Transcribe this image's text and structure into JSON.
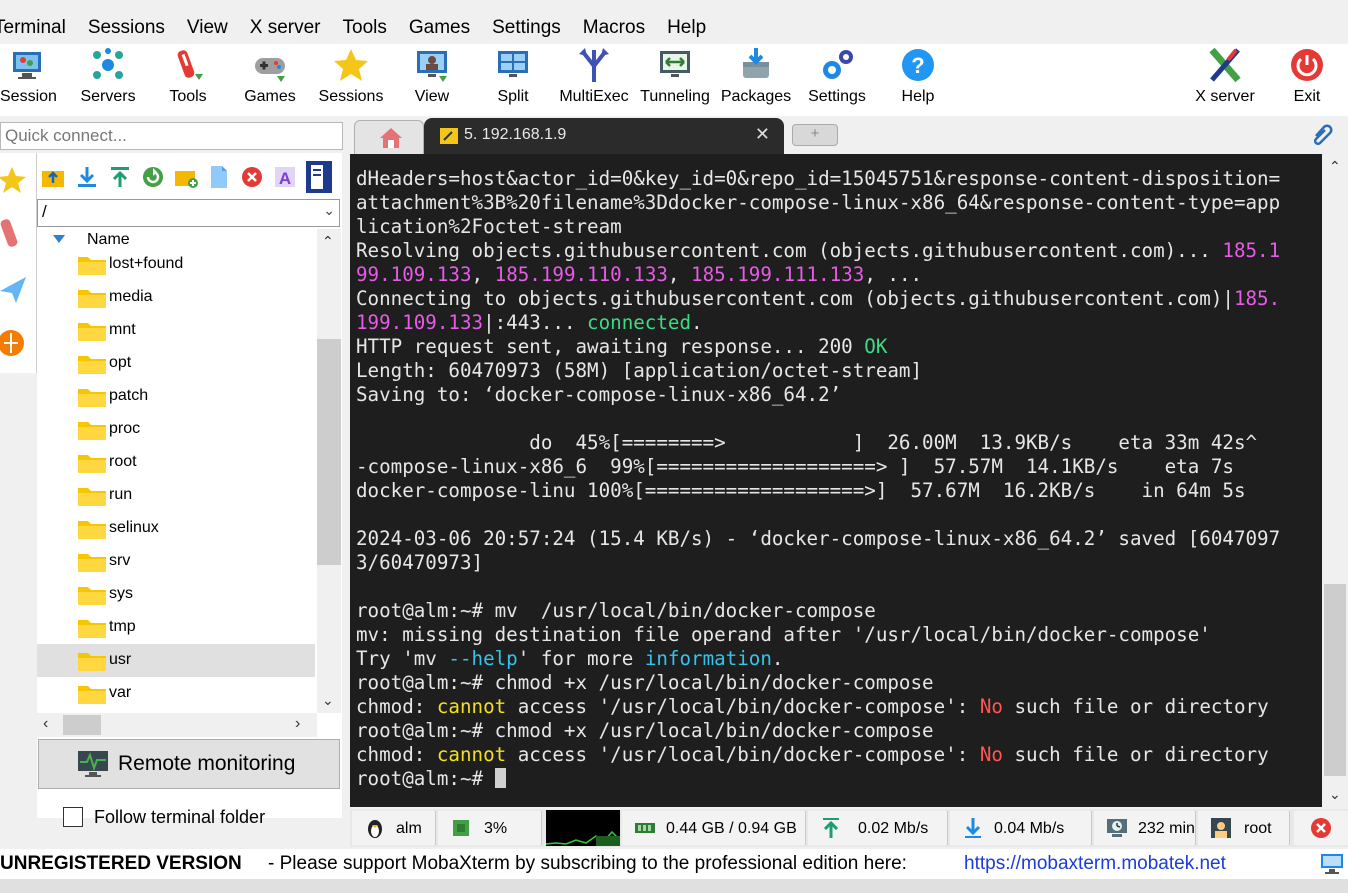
{
  "menu": [
    "Terminal",
    "Sessions",
    "View",
    "X server",
    "Tools",
    "Games",
    "Settings",
    "Macros",
    "Help"
  ],
  "toolbar": {
    "session": "Session",
    "servers": "Servers",
    "tools": "Tools",
    "games": "Games",
    "sessions": "Sessions",
    "view": "View",
    "split": "Split",
    "multiexec": "MultiExec",
    "tunneling": "Tunneling",
    "packages": "Packages",
    "settings": "Settings",
    "help": "Help",
    "xserver": "X server",
    "exit": "Exit"
  },
  "quick_connect": {
    "placeholder": "Quick connect..."
  },
  "tabs": {
    "active_label": "5. 192.168.1.9",
    "close": "✕",
    "add": "+"
  },
  "sftp": {
    "path": "/",
    "column_name": "Name",
    "items": [
      "lost+found",
      "media",
      "mnt",
      "opt",
      "patch",
      "proc",
      "root",
      "run",
      "selinux",
      "srv",
      "sys",
      "tmp",
      "usr",
      "var"
    ],
    "selected": "usr",
    "remote_monitoring": "Remote monitoring",
    "follow_terminal": "Follow terminal folder"
  },
  "terminal": {
    "lines": [
      [
        {
          "t": "dHeaders=host&actor_id=0&key_id=0&repo_id=15045751&response-content-disposition="
        }
      ],
      [
        {
          "t": "attachment%3B%20filename%3Ddocker-compose-linux-x86_64&response-content-type=app"
        }
      ],
      [
        {
          "t": "lication%2Foctet-stream"
        }
      ],
      [
        {
          "t": "Resolving objects.githubusercontent.com (objects.githubusercontent.com)... "
        },
        {
          "t": "185.1",
          "c": "mag"
        }
      ],
      [
        {
          "t": "99.109.133",
          "c": "mag"
        },
        {
          "t": ", "
        },
        {
          "t": "185.199.110.133",
          "c": "mag"
        },
        {
          "t": ", "
        },
        {
          "t": "185.199.111.133",
          "c": "mag"
        },
        {
          "t": ", ..."
        }
      ],
      [
        {
          "t": "Connecting to objects.githubusercontent.com (objects.githubusercontent.com)|"
        },
        {
          "t": "185.",
          "c": "mag"
        }
      ],
      [
        {
          "t": "199.109.133",
          "c": "mag"
        },
        {
          "t": "|:443... "
        },
        {
          "t": "connected",
          "c": "grn"
        },
        {
          "t": "."
        }
      ],
      [
        {
          "t": "HTTP request sent, awaiting response... 200 "
        },
        {
          "t": "OK",
          "c": "grn"
        }
      ],
      [
        {
          "t": "Length: 60470973 (58M) [application/octet-stream]"
        }
      ],
      [
        {
          "t": "Saving to: ‘docker-compose-linux-x86_64.2’"
        }
      ],
      [
        {
          "t": ""
        }
      ],
      [
        {
          "t": "               do  45%[========>           ]  26.00M  13.9KB/s    eta 33m 42s^"
        }
      ],
      [
        {
          "t": "-compose-linux-x86_6  99%[===================> ]  57.57M  14.1KB/s    eta 7s"
        }
      ],
      [
        {
          "t": "docker-compose-linu 100%[===================>]  57.67M  16.2KB/s    in 64m 5s"
        }
      ],
      [
        {
          "t": ""
        }
      ],
      [
        {
          "t": "2024-03-06 20:57:24 (15.4 KB/s) - ‘docker-compose-linux-x86_64.2’ saved [6047097"
        }
      ],
      [
        {
          "t": "3/60470973]"
        }
      ],
      [
        {
          "t": ""
        }
      ],
      [
        {
          "t": "root@alm:~# mv  /usr/local/bin/docker-compose"
        }
      ],
      [
        {
          "t": "mv: missing destination file operand after '/usr/local/bin/docker-compose'"
        }
      ],
      [
        {
          "t": "Try 'mv "
        },
        {
          "t": "--help",
          "c": "cyn"
        },
        {
          "t": "' for more "
        },
        {
          "t": "information",
          "c": "cyn"
        },
        {
          "t": "."
        }
      ],
      [
        {
          "t": "root@alm:~# chmod +x /usr/local/bin/docker-compose"
        }
      ],
      [
        {
          "t": "chmod: "
        },
        {
          "t": "cannot",
          "c": "yel"
        },
        {
          "t": " access '/usr/local/bin/docker-compose': "
        },
        {
          "t": "No",
          "c": "red"
        },
        {
          "t": " such file or directory"
        }
      ],
      [
        {
          "t": "root@alm:~# chmod +x /usr/local/bin/docker-compose"
        }
      ],
      [
        {
          "t": "chmod: "
        },
        {
          "t": "cannot",
          "c": "yel"
        },
        {
          "t": " access '/usr/local/bin/docker-compose': "
        },
        {
          "t": "No",
          "c": "red"
        },
        {
          "t": " such file or directory"
        }
      ],
      [
        {
          "t": "root@alm:~# "
        }
      ]
    ]
  },
  "status": {
    "host": "alm",
    "cpu": "3%",
    "memory": "0.44 GB / 0.94 GB",
    "upload": "0.02 Mb/s",
    "download": "0.04 Mb/s",
    "uptime": "232 min",
    "user": "root"
  },
  "unregistered": {
    "title": "UNREGISTERED VERSION",
    "message": " -  Please support MobaXterm by subscribing to the professional edition here:",
    "link": "https://mobaxterm.mobatek.net"
  },
  "colors": {
    "terminal_bg": "#1e1e1e",
    "magenta": "#e85ae8",
    "green": "#3ddc84",
    "yellow": "#f0e020",
    "red": "#ff5555",
    "cyan": "#36c3e8",
    "link": "#1a3cd8"
  }
}
